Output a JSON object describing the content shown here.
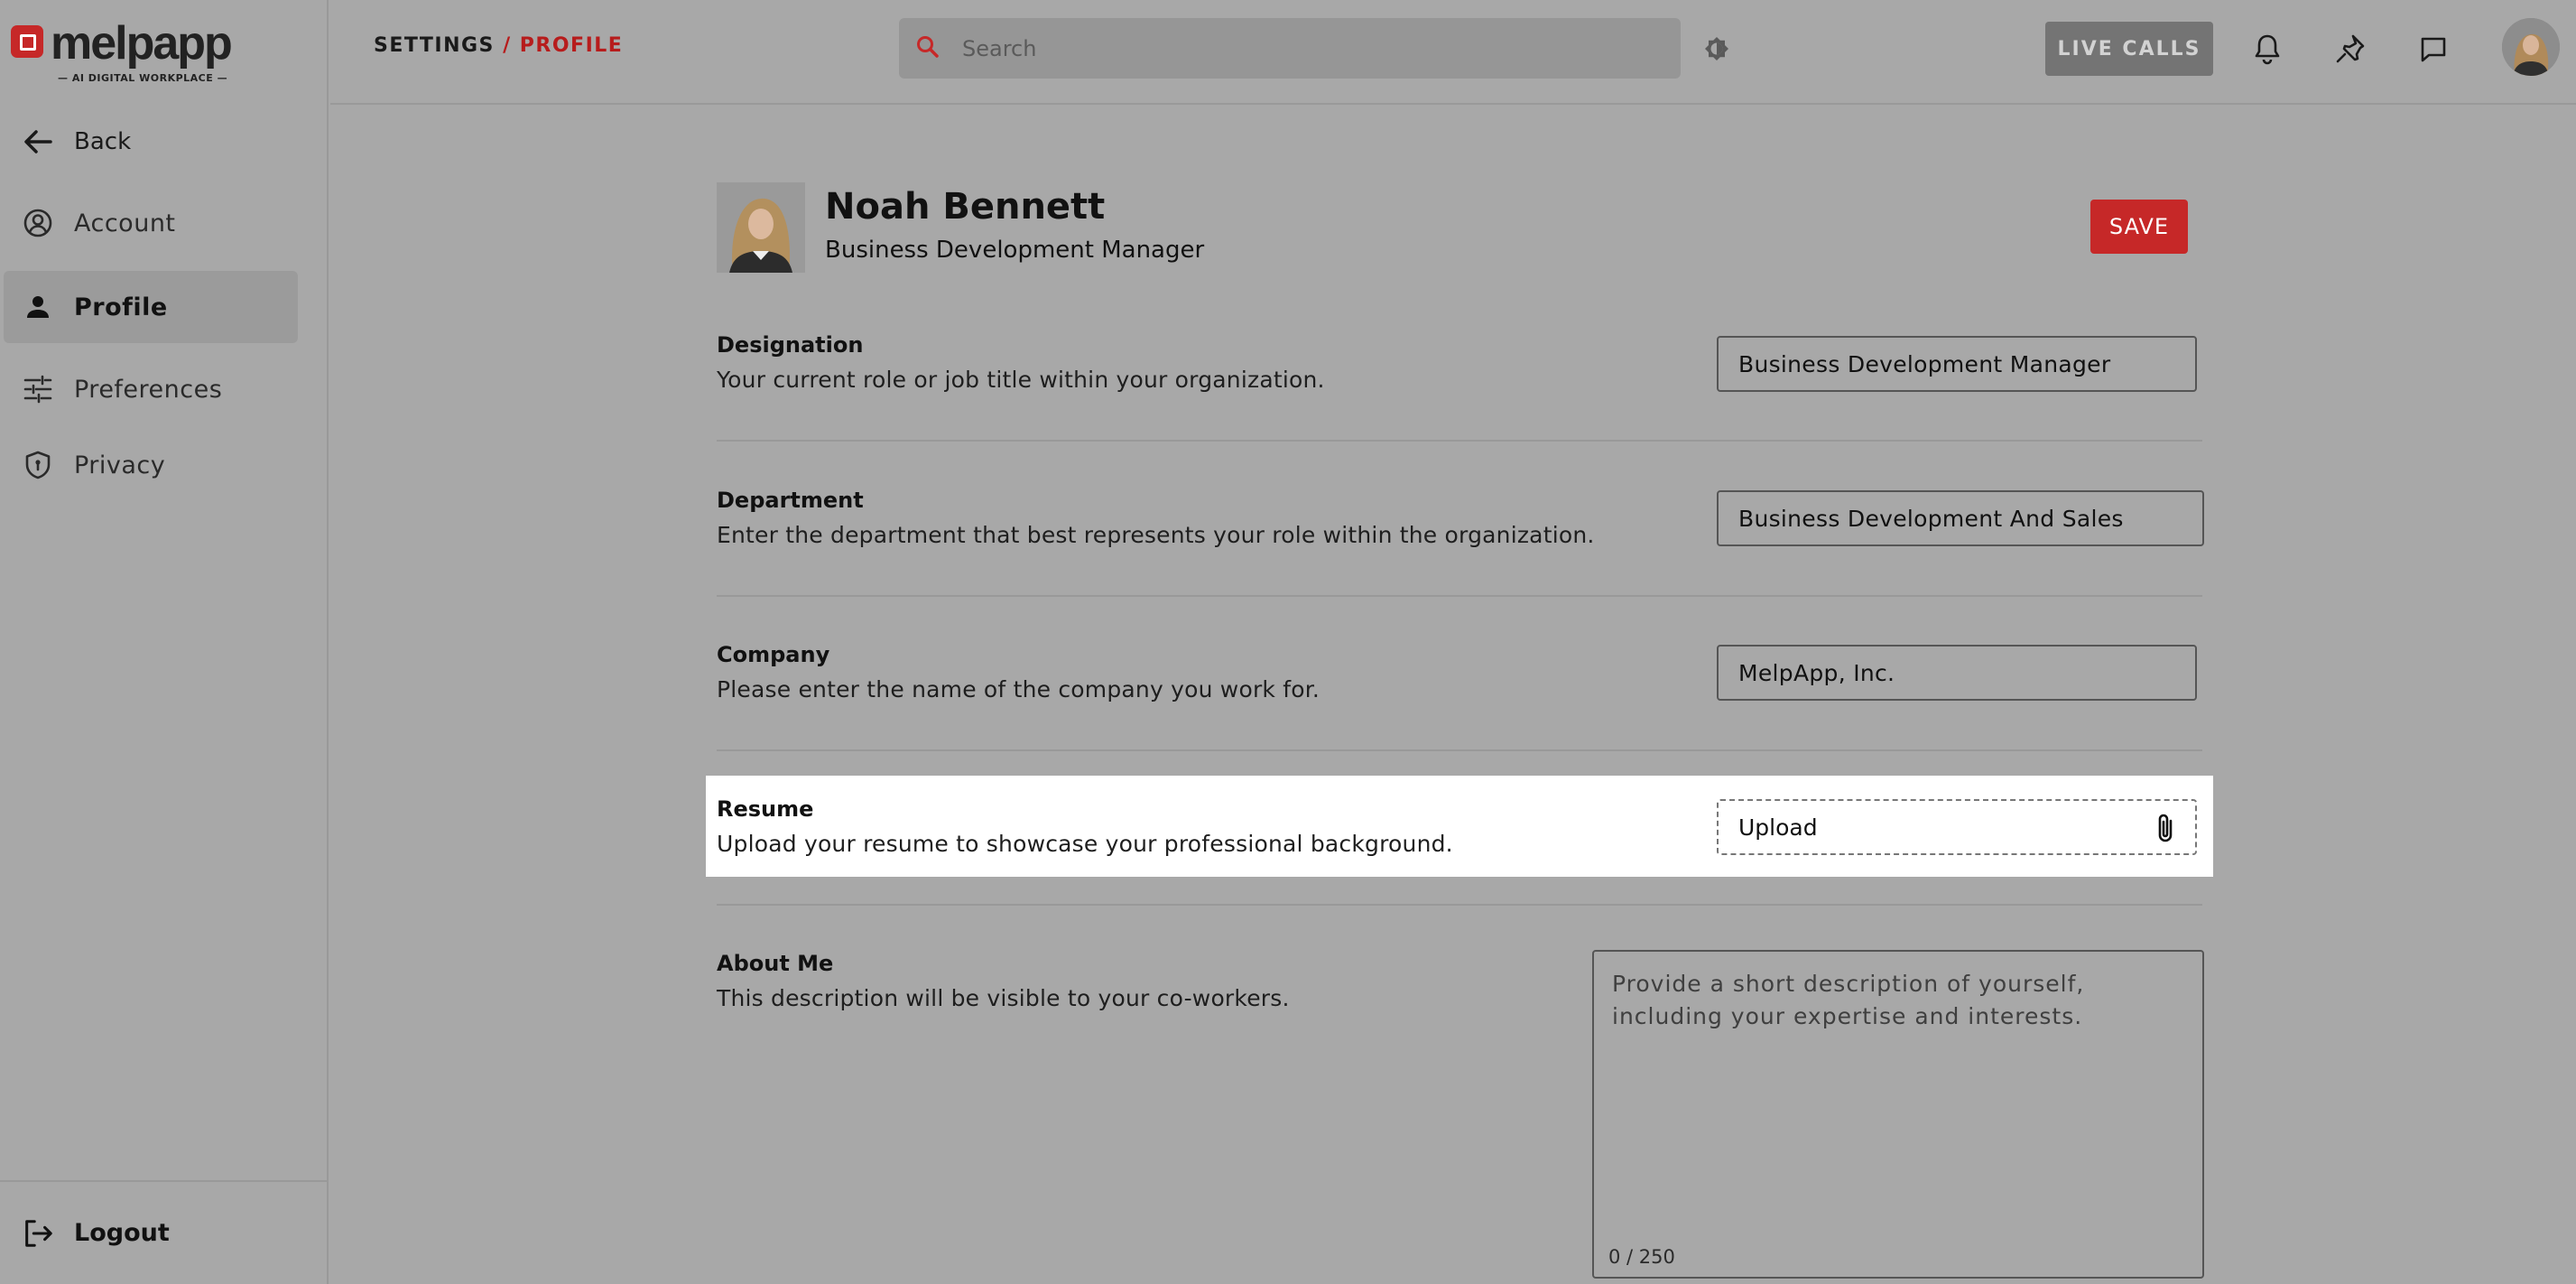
{
  "brand": {
    "name": "melpapp",
    "tagline": "— AI DIGITAL WORKPLACE —",
    "accent": "#c62828"
  },
  "sidebar": {
    "back_label": "Back",
    "items": [
      {
        "label": "Account",
        "icon": "account-circle-icon"
      },
      {
        "label": "Profile",
        "icon": "person-icon",
        "active": true
      },
      {
        "label": "Preferences",
        "icon": "sliders-icon"
      },
      {
        "label": "Privacy",
        "icon": "shield-icon"
      }
    ],
    "logout_label": "Logout"
  },
  "header": {
    "breadcrumb_root": "SETTINGS",
    "breadcrumb_current": "/ PROFILE",
    "search_placeholder": "Search",
    "live_calls_label": "LIVE CALLS"
  },
  "profile": {
    "name": "Noah Bennett",
    "role": "Business Development Manager",
    "save_label": "SAVE"
  },
  "fields": [
    {
      "title": "Designation",
      "description": "Your current role or job title within your organization.",
      "value": "Business Development Manager"
    },
    {
      "title": "Department",
      "description": "Enter the department that best represents your role within the organization.",
      "value": "Business Development And Sales"
    },
    {
      "title": "Company",
      "description": "Please enter the name of the company you work for.",
      "value": "MelpApp, Inc."
    },
    {
      "title": "Resume",
      "description": "Upload your resume to showcase your professional background.",
      "value": "Upload"
    },
    {
      "title": "About Me",
      "description": "This description will be visible to your co-workers.",
      "placeholder": "Provide a short description of yourself, including your expertise and interests.",
      "counter": "0 / 250"
    }
  ]
}
